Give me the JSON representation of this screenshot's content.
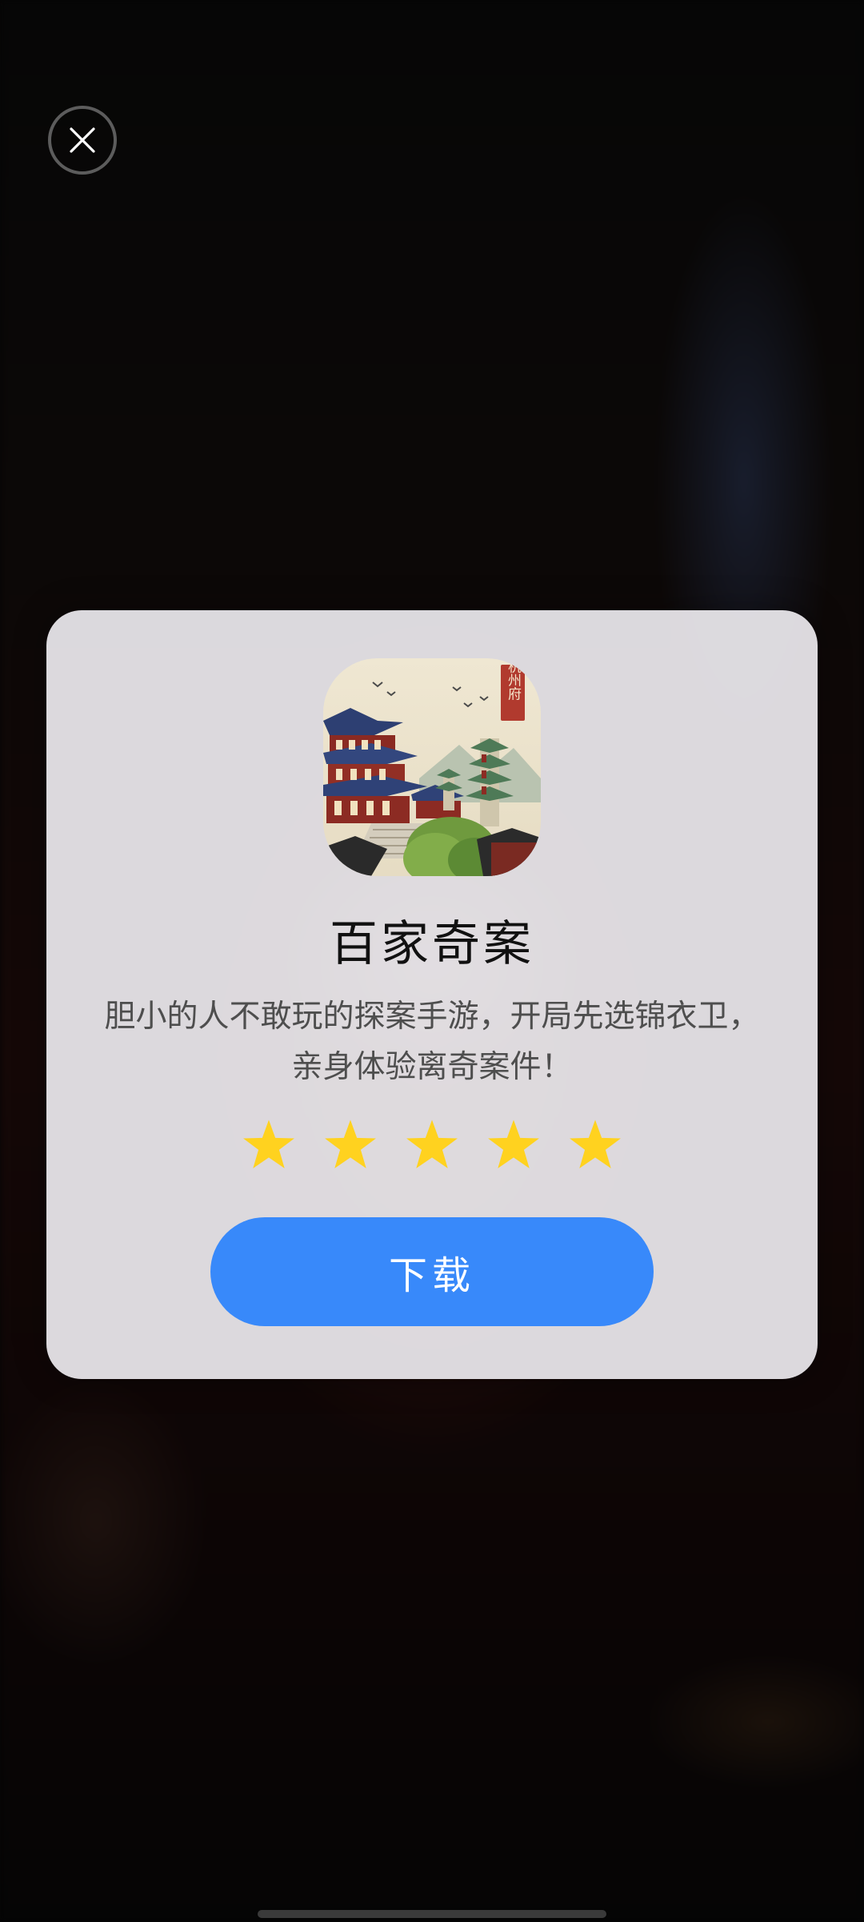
{
  "dialog": {
    "app_name": "百家奇案",
    "description": "胆小的人不敢玩的探案手游，开局先选锦衣卫，亲身体验离奇案件！",
    "rating": 5,
    "rating_max": 5,
    "download_label": "下载",
    "icon_seal_text": "杭州府"
  },
  "colors": {
    "accent": "#3889fa",
    "star": "#ffd21f",
    "card_bg": "#eceaee"
  },
  "icons": {
    "close": "close-icon",
    "star": "star-icon"
  }
}
